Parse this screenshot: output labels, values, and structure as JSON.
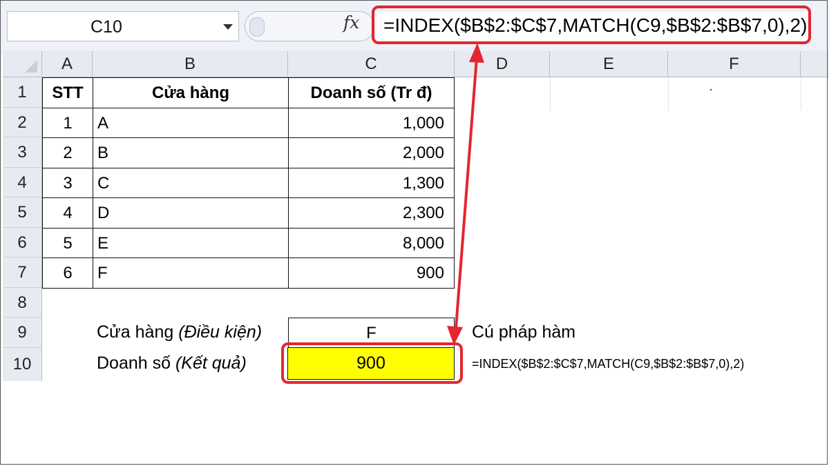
{
  "formula_bar": {
    "name_box": "C10",
    "fx_icon": "fx-icon",
    "formula": "=INDEX($B$2:$C$7,MATCH(C9,$B$2:$B$7,0),2)"
  },
  "columns": [
    "A",
    "B",
    "C",
    "D",
    "E",
    "F"
  ],
  "rows": [
    "1",
    "2",
    "3",
    "4",
    "5",
    "6",
    "7",
    "8",
    "9",
    "10"
  ],
  "table": {
    "headers": [
      "STT",
      "Cửa hàng",
      "Doanh số (Tr đ)"
    ],
    "data": [
      [
        "1",
        "A",
        "1,000"
      ],
      [
        "2",
        "B",
        "2,000"
      ],
      [
        "3",
        "C",
        "1,300"
      ],
      [
        "4",
        "D",
        "2,300"
      ],
      [
        "5",
        "E",
        "8,000"
      ],
      [
        "6",
        "F",
        "900"
      ]
    ]
  },
  "lookup": {
    "condition_label": "Cửa hàng ",
    "condition_label_italic": "(Điều kiện)",
    "condition_value": "F",
    "result_label": "Doanh số ",
    "result_label_italic": "(Kết quả)",
    "result_value": "900"
  },
  "syntax": {
    "label": "Cú pháp hàm",
    "formula": "=INDEX($B$2:$C$7,MATCH(C9,$B$2:$B$7,0),2)"
  },
  "colors": {
    "highlight": "#e3262f",
    "result_fill": "#ffff00",
    "header_bg": "#e7ebf1"
  }
}
